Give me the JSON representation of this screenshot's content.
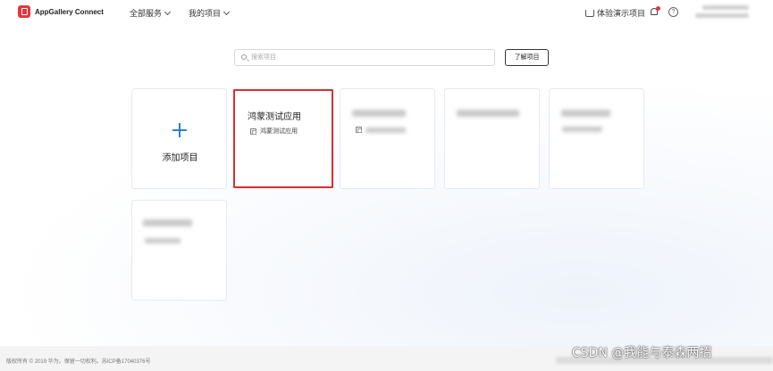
{
  "header": {
    "logo_text": "AppGallery Connect",
    "nav": [
      {
        "label": "全部服务"
      },
      {
        "label": "我的项目"
      }
    ],
    "demo_label": "体验演示项目",
    "help_symbol": "?"
  },
  "search": {
    "placeholder": "搜索项目",
    "learn_button": "了解项目"
  },
  "cards": {
    "add_label": "添加项目",
    "selected_title": "鸿蒙测试应用",
    "selected_app": "鸿蒙测试应用"
  },
  "footer": {
    "copyright": "版权所有 © 2019 华为。保留一切权利。苏ICP备17040376号"
  },
  "watermark": "CSDN @我能与泰森两招",
  "colors": {
    "accent": "#2b7fd6",
    "brand_red": "#e8363c",
    "selected_border": "#d62f35"
  }
}
